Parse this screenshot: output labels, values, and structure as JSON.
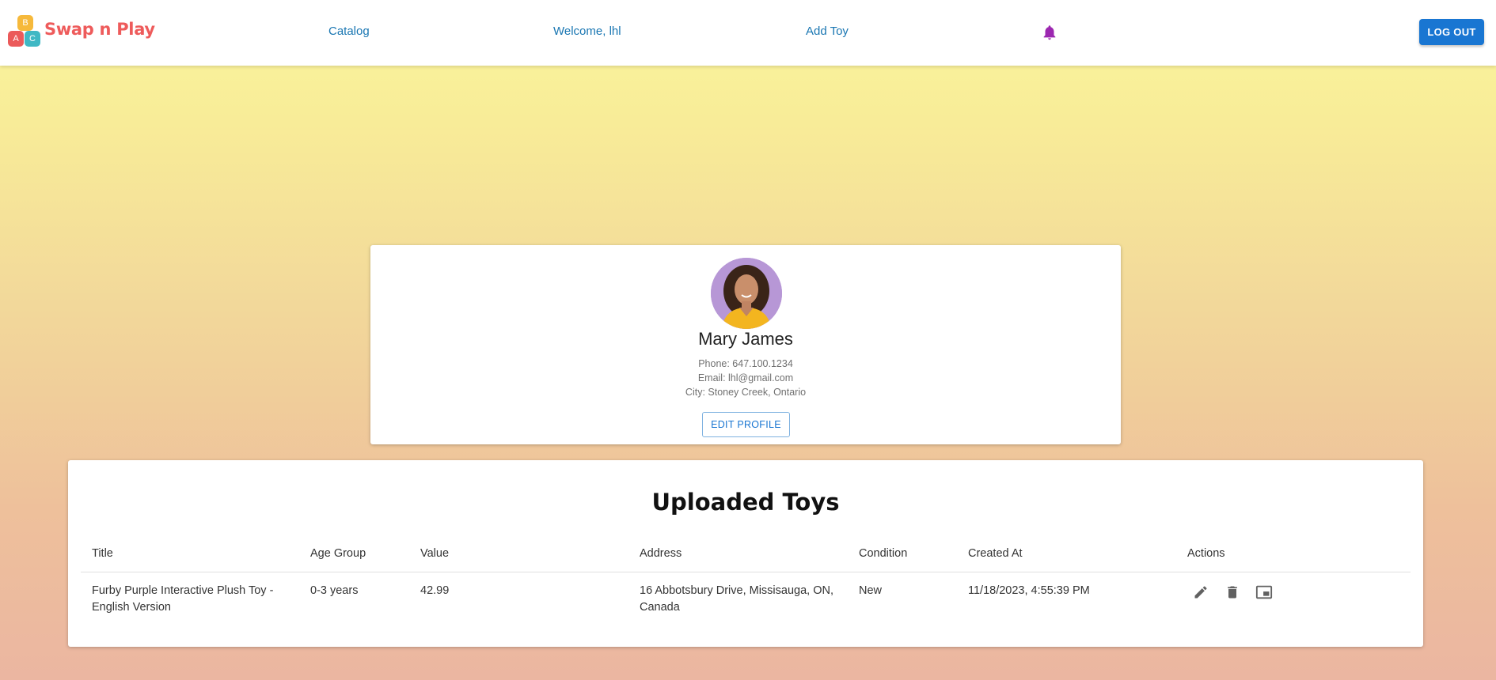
{
  "brand": {
    "name": "Swap n Play",
    "blocks": [
      "B",
      "A",
      "C"
    ]
  },
  "nav": {
    "catalog": "Catalog",
    "welcome": "Welcome, lhl",
    "add_toy": "Add Toy",
    "logout": "LOG OUT",
    "bell_icon": "bell-icon"
  },
  "colors": {
    "brand": "#ee5b5b",
    "link": "#1976b2",
    "primary": "#1976d2",
    "bell": "#9c27b0"
  },
  "profile": {
    "name": "Mary James",
    "phone": "Phone: 647.100.1234",
    "email": "Email: lhl@gmail.com",
    "city": "City: Stoney Creek, Ontario",
    "edit_label": "EDIT PROFILE"
  },
  "toys": {
    "title": "Uploaded Toys",
    "columns": [
      "Title",
      "Age Group",
      "Value",
      "Address",
      "Condition",
      "Created At",
      "Actions"
    ],
    "rows": [
      {
        "title": "Furby Purple Interactive Plush Toy - English Version",
        "age_group": "0-3 years",
        "value": "42.99",
        "address": "16 Abbotsbury Drive, Missisauga, ON, Canada",
        "condition": "New",
        "created_at": "11/18/2023, 4:55:39 PM",
        "actions": [
          "edit-icon",
          "delete-icon",
          "picture-in-picture-icon"
        ]
      }
    ]
  }
}
